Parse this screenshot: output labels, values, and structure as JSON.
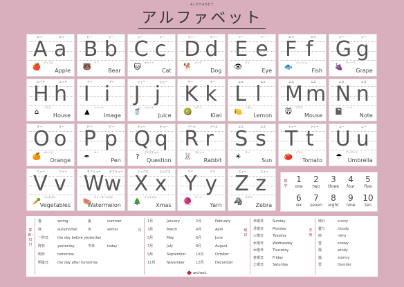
{
  "header": {
    "subtitle": "ALPHABET",
    "title": "アルファベット"
  },
  "cards": [
    {
      "U": "A",
      "l": "a",
      "k1": "エイ",
      "k2": "エイ",
      "word": "Apple",
      "wkana": "アップル",
      "icon": "apple-icon",
      "glyph": "🍎"
    },
    {
      "U": "B",
      "l": "b",
      "k1": "ビー",
      "k2": "ビー",
      "word": "Bear",
      "wkana": "ベア",
      "icon": "bear-icon",
      "glyph": "🐻"
    },
    {
      "U": "C",
      "l": "c",
      "k1": "シー",
      "k2": "シー",
      "word": "Cat",
      "wkana": "キャット",
      "icon": "cat-icon",
      "glyph": "🐱"
    },
    {
      "U": "D",
      "l": "d",
      "k1": "ディー",
      "k2": "ディー",
      "word": "Dog",
      "wkana": "ドッグ",
      "icon": "dog-icon",
      "glyph": "🐕"
    },
    {
      "U": "E",
      "l": "e",
      "k1": "イー",
      "k2": "イー",
      "word": "Eye",
      "wkana": "アイ",
      "icon": "eye-icon",
      "glyph": "👁"
    },
    {
      "U": "F",
      "l": "f",
      "k1": "エフ",
      "k2": "エフ",
      "word": "Fish",
      "wkana": "フィッシュ",
      "icon": "fish-icon",
      "glyph": "🐟"
    },
    {
      "U": "G",
      "l": "g",
      "k1": "ジー",
      "k2": "ジー",
      "word": "Grape",
      "wkana": "グレープ",
      "icon": "grape-icon",
      "glyph": "🍇"
    },
    {
      "U": "H",
      "l": "h",
      "k1": "エイチ",
      "k2": "エイチ",
      "word": "House",
      "wkana": "ハウス",
      "icon": "house-icon",
      "glyph": "⌂"
    },
    {
      "U": "I",
      "l": "i",
      "k1": "アイ",
      "k2": "アイ",
      "word": "Image",
      "wkana": "イメージ",
      "icon": "image-icon",
      "glyph": "▲"
    },
    {
      "U": "J",
      "l": "j",
      "k1": "ジェー",
      "k2": "ジェー",
      "word": "Juice",
      "wkana": "ジュース",
      "icon": "juice-icon",
      "glyph": "🥤"
    },
    {
      "U": "K",
      "l": "k",
      "k1": "ケー",
      "k2": "ケー",
      "word": "Kiwi",
      "wkana": "キウイ",
      "icon": "kiwi-icon",
      "glyph": "🥝"
    },
    {
      "U": "L",
      "l": "l",
      "k1": "エル",
      "k2": "エル",
      "word": "Lemon",
      "wkana": "レモン",
      "icon": "lemon-icon",
      "glyph": "🍋"
    },
    {
      "U": "M",
      "l": "m",
      "k1": "エム",
      "k2": "エム",
      "word": "Mouse",
      "wkana": "マウス",
      "icon": "mouse-icon",
      "glyph": "🐭"
    },
    {
      "U": "N",
      "l": "n",
      "k1": "エヌ",
      "k2": "エヌ",
      "word": "Note",
      "wkana": "ノート",
      "icon": "note-icon",
      "glyph": "📓"
    },
    {
      "U": "O",
      "l": "o",
      "k1": "オー",
      "k2": "オー",
      "word": "Orange",
      "wkana": "オレンジ",
      "icon": "orange-icon",
      "glyph": "🍊"
    },
    {
      "U": "P",
      "l": "p",
      "k1": "ピー",
      "k2": "ピー",
      "word": "Pen",
      "wkana": "ペン",
      "icon": "pen-icon",
      "glyph": "✒"
    },
    {
      "U": "Q",
      "l": "q",
      "k1": "キュー",
      "k2": "キュー",
      "word": "Question",
      "wkana": "クエスチョン",
      "icon": "question-icon",
      "glyph": "?"
    },
    {
      "U": "R",
      "l": "r",
      "k1": "アール",
      "k2": "アール",
      "word": "Rabbit",
      "wkana": "ラビット",
      "icon": "rabbit-icon",
      "glyph": "🐰"
    },
    {
      "U": "S",
      "l": "s",
      "k1": "エス",
      "k2": "エス",
      "word": "Sun",
      "wkana": "サン",
      "icon": "sun-icon",
      "glyph": "☀"
    },
    {
      "U": "T",
      "l": "t",
      "k1": "ティー",
      "k2": "ティー",
      "word": "Tomato",
      "wkana": "トマト",
      "icon": "tomato-icon",
      "glyph": "🍅"
    },
    {
      "U": "U",
      "l": "u",
      "k1": "ユー",
      "k2": "ユー",
      "word": "Umbrella",
      "wkana": "アンブレラ",
      "icon": "umbrella-icon",
      "glyph": "☂"
    },
    {
      "U": "V",
      "l": "v",
      "k1": "ヴィー",
      "k2": "ヴィー",
      "word": "Vegetables",
      "wkana": "ベジタブル",
      "icon": "vegetables-icon",
      "glyph": "🥕"
    },
    {
      "U": "W",
      "l": "w",
      "k1": "ダブリュー",
      "k2": "ダブリュー",
      "word": "Watermelon",
      "wkana": "ウォーターメロン",
      "icon": "watermelon-icon",
      "glyph": "🍉"
    },
    {
      "U": "X",
      "l": "x",
      "k1": "エックス",
      "k2": "エックス",
      "word": "Xmas",
      "wkana": "クリスマス",
      "icon": "tree-icon",
      "glyph": "🎄"
    },
    {
      "U": "Y",
      "l": "y",
      "k1": "ワイ",
      "k2": "ワイ",
      "word": "Yarn",
      "wkana": "ヤーン",
      "icon": "yarn-icon",
      "glyph": "🧶"
    },
    {
      "U": "Z",
      "l": "z",
      "k1": "ズィー",
      "k2": "ズィー",
      "word": "Zebra",
      "wkana": "ゼブラ",
      "icon": "zebra-icon",
      "glyph": "🦓"
    }
  ],
  "numbers": {
    "title": "数字",
    "items": [
      {
        "n": "1",
        "w": "one"
      },
      {
        "n": "2",
        "w": "two"
      },
      {
        "n": "3",
        "w": "three"
      },
      {
        "n": "4",
        "w": "four"
      },
      {
        "n": "5",
        "w": "five"
      },
      {
        "n": "6",
        "w": "six"
      },
      {
        "n": "7",
        "w": "seven"
      },
      {
        "n": "8",
        "w": "eight"
      },
      {
        "n": "9",
        "w": "nine"
      },
      {
        "n": "10",
        "w": "ten"
      }
    ]
  },
  "seasons": {
    "title": "季節・日付",
    "rows": [
      {
        "jp": "春",
        "en": "spring",
        "jp2": "夏",
        "en2": "summer"
      },
      {
        "jp": "秋",
        "en": "autumn/fall",
        "jp2": "冬",
        "en2": "winter"
      },
      {
        "jp": "一昨日",
        "en": "the day before yesterday"
      },
      {
        "jp": "昨日",
        "en": "yesterday",
        "jp2": "今日",
        "en2": "today"
      },
      {
        "jp": "明日",
        "en": "tomorrow"
      },
      {
        "jp": "明後日",
        "en": "the day after tomorrow"
      }
    ]
  },
  "months": {
    "title": "月",
    "rows": [
      {
        "jp": "1月",
        "en": "January",
        "jp2": "2月",
        "en2": "February"
      },
      {
        "jp": "3月",
        "en": "March",
        "jp2": "4月",
        "en2": "April"
      },
      {
        "jp": "5月",
        "en": "May",
        "jp2": "6月",
        "en2": "June"
      },
      {
        "jp": "7月",
        "en": "July",
        "jp2": "8月",
        "en2": "August"
      },
      {
        "jp": "9月",
        "en": "September",
        "jp2": "10月",
        "en2": "October"
      },
      {
        "jp": "11月",
        "en": "November",
        "jp2": "12月",
        "en2": "December"
      }
    ]
  },
  "weekdays": {
    "title": "曜日",
    "rows": [
      {
        "jp": "日曜日",
        "en": "Sunday"
      },
      {
        "jp": "月曜日",
        "en": "Monday"
      },
      {
        "jp": "火曜日",
        "en": "Tuesday"
      },
      {
        "jp": "水曜日",
        "en": "Wednesday"
      },
      {
        "jp": "木曜日",
        "en": "Thursday"
      },
      {
        "jp": "金曜日",
        "en": "Friday"
      },
      {
        "jp": "土曜日",
        "en": "Saturday"
      }
    ]
  },
  "weather": {
    "title": "天気",
    "rows": [
      {
        "jp": "晴れ",
        "en": "sunny"
      },
      {
        "jp": "曇り",
        "en": "cloudy"
      },
      {
        "jp": "雨",
        "en": "rainy"
      },
      {
        "jp": "雪",
        "en": "snowy"
      },
      {
        "jp": "風",
        "en": "windy"
      },
      {
        "jp": "嵐",
        "en": "stormy"
      },
      {
        "jp": "雷",
        "en": "thunder"
      }
    ]
  },
  "logo": {
    "text": "archest."
  },
  "colors": {
    "background": "#d9aebd",
    "accent": "#a45"
  }
}
